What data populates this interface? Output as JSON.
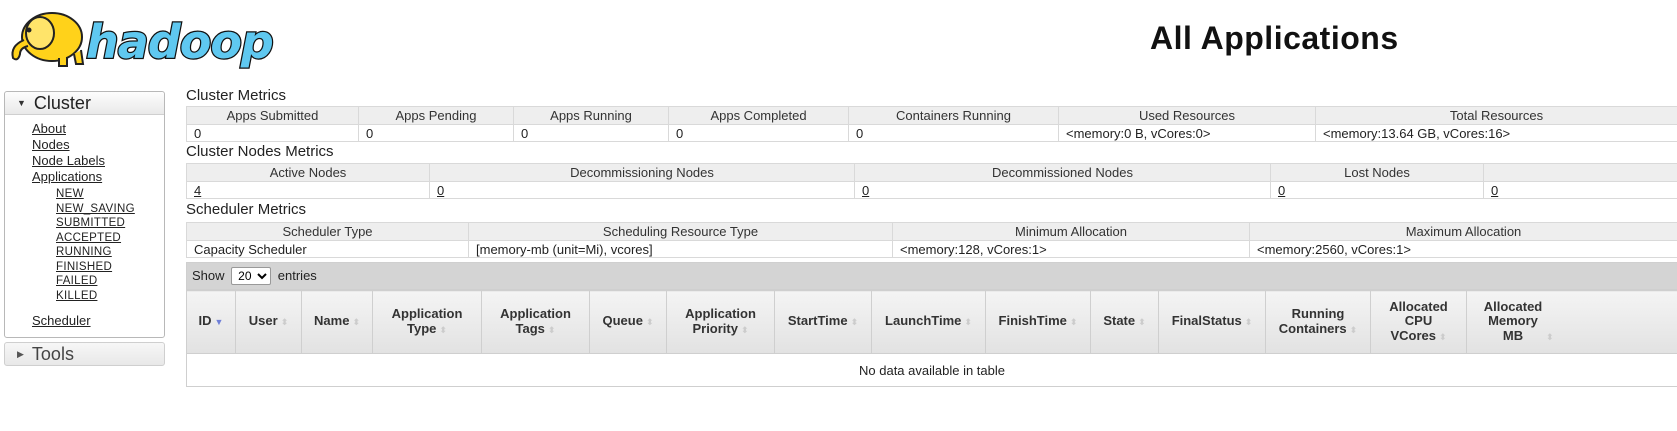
{
  "header": {
    "logo_text": "hadoop",
    "title": "All Applications"
  },
  "sidebar": {
    "cluster": {
      "title": "Cluster",
      "links": [
        "About",
        "Nodes",
        "Node Labels",
        "Applications"
      ],
      "app_states": [
        "NEW",
        "NEW_SAVING",
        "SUBMITTED",
        "ACCEPTED",
        "RUNNING",
        "FINISHED",
        "FAILED",
        "KILLED"
      ],
      "scheduler": "Scheduler"
    },
    "tools": {
      "title": "Tools"
    }
  },
  "cluster_metrics": {
    "title": "Cluster Metrics",
    "headers": [
      "Apps Submitted",
      "Apps Pending",
      "Apps Running",
      "Apps Completed",
      "Containers Running",
      "Used Resources",
      "Total Resources"
    ],
    "values": [
      "0",
      "0",
      "0",
      "0",
      "0",
      "<memory:0 B, vCores:0>",
      "<memory:13.64 GB, vCores:16>"
    ]
  },
  "node_metrics": {
    "title": "Cluster Nodes Metrics",
    "headers": [
      "Active Nodes",
      "Decommissioning Nodes",
      "Decommissioned Nodes",
      "Lost Nodes",
      ""
    ],
    "values": [
      "4",
      "0",
      "0",
      "0",
      "0"
    ]
  },
  "scheduler_metrics": {
    "title": "Scheduler Metrics",
    "headers": [
      "Scheduler Type",
      "Scheduling Resource Type",
      "Minimum Allocation",
      "Maximum Allocation"
    ],
    "values": [
      "Capacity Scheduler",
      "[memory-mb (unit=Mi), vcores]",
      "<memory:128, vCores:1>",
      "<memory:2560, vCores:1>"
    ]
  },
  "apps_table": {
    "show_label": "Show",
    "entries_value": "20",
    "entries_label": "entries",
    "columns": [
      "ID",
      "User",
      "Name",
      "Application Type",
      "Application Tags",
      "Queue",
      "Application Priority",
      "StartTime",
      "LaunchTime",
      "FinishTime",
      "State",
      "FinalStatus",
      "Running Containers",
      "Allocated CPU VCores",
      "Allocated Memory MB"
    ],
    "empty_message": "No data available in table"
  },
  "colors": {
    "logo_yellow": "#ffd21a",
    "logo_blue": "#5fc8f0",
    "sort_active": "#6f7fd8"
  }
}
